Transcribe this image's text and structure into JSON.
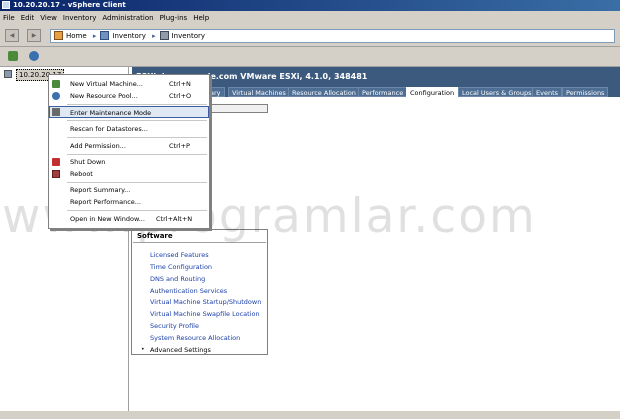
{
  "window": {
    "title": "10.20.20.17 - vSphere Client"
  },
  "menubar": {
    "items": [
      "File",
      "Edit",
      "View",
      "Inventory",
      "Administration",
      "Plug-ins",
      "Help"
    ]
  },
  "navbar": {
    "home": "Home",
    "crumb1": "Inventory",
    "crumb2": "Inventory"
  },
  "tree": {
    "host": "10.20.20.17"
  },
  "host_header": "ESXi dev.example.com VMware ESXi, 4.1.0, 348481",
  "tabs": [
    "ary",
    "Virtual Machines",
    "Resource Allocation",
    "Performance",
    "Configuration",
    "Local Users & Groups",
    "Events",
    "Permissions"
  ],
  "active_tab": "Configuration",
  "context_menu": {
    "items": [
      {
        "label": "New Virtual Machine...",
        "shortcut": "Ctrl+N",
        "icon": "new-vm-icon"
      },
      {
        "label": "New Resource Pool...",
        "shortcut": "Ctrl+O",
        "icon": "resource-pool-icon"
      },
      {
        "label": "Enter Maintenance Mode",
        "shortcut": "",
        "icon": "maintenance-icon"
      },
      {
        "label": "Rescan for Datastores...",
        "shortcut": "",
        "icon": ""
      },
      {
        "label": "Add Permission...",
        "shortcut": "Ctrl+P",
        "icon": ""
      },
      {
        "label": "Shut Down",
        "shortcut": "",
        "icon": "shutdown-icon"
      },
      {
        "label": "Reboot",
        "shortcut": "",
        "icon": "reboot-icon"
      },
      {
        "label": "Report Summary...",
        "shortcut": "",
        "icon": ""
      },
      {
        "label": "Report Performance...",
        "shortcut": "",
        "icon": ""
      },
      {
        "label": "Open in New Window...",
        "shortcut": "Ctrl+Alt+N",
        "icon": ""
      }
    ]
  },
  "software": {
    "title": "Software",
    "links": [
      "Licensed Features",
      "Time Configuration",
      "DNS and Routing",
      "Authentication Services",
      "Virtual Machine Startup/Shutdown",
      "Virtual Machine Swapfile Location",
      "Security Profile",
      "System Resource Allocation",
      "Advanced Settings"
    ]
  },
  "watermark": "www.programlar.com",
  "colors": {
    "header_bg": "#3c5a7d",
    "link": "#1a3fa8",
    "chrome": "#d4d0c8",
    "title_bg": "#0a246a"
  }
}
